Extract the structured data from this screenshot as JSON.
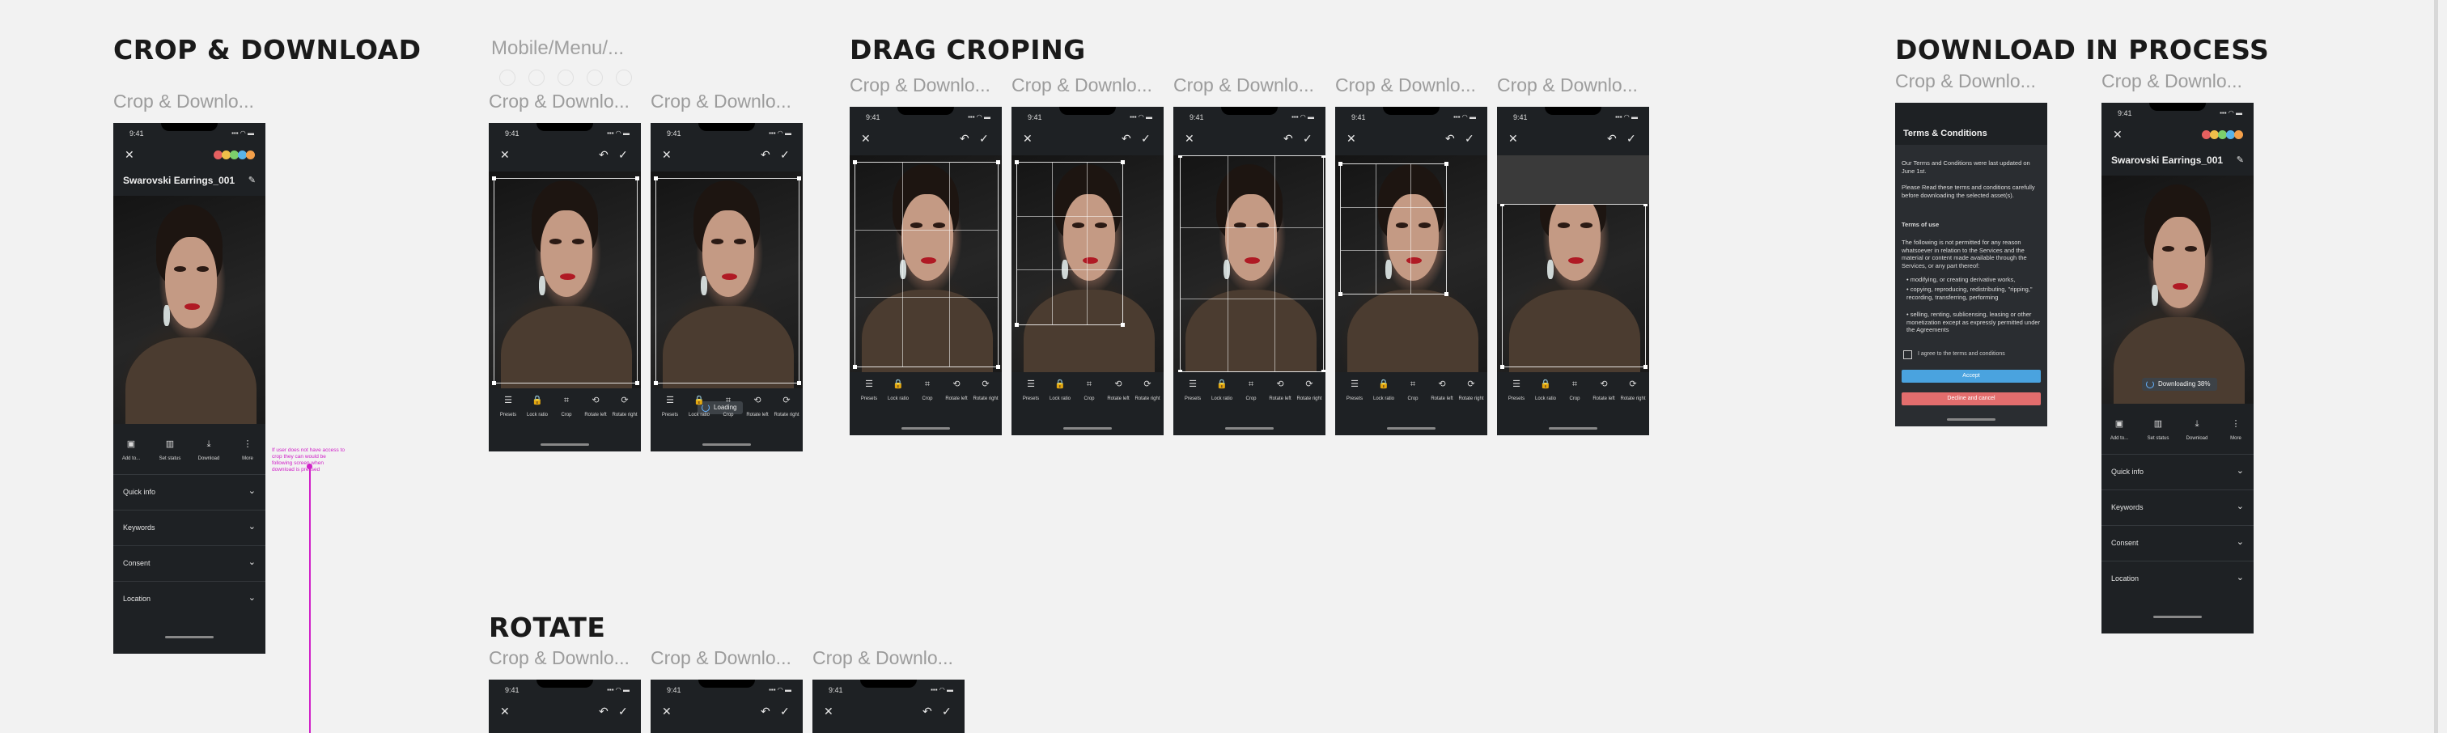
{
  "sections": {
    "crop_download": "CROP & DOWNLOAD",
    "mobile_menu": "Mobile/Menu/...",
    "drag_croping": "DRAG CROPING",
    "download_in_process": "DOWNLOAD IN PROCESS",
    "rotate": "ROTATE"
  },
  "frame_label": "Crop & Downlo...",
  "status": {
    "time": "9:41",
    "signal": "▪▪▪ ◠ ▬"
  },
  "asset": {
    "title": "Swarovski Earrings_001",
    "colors": [
      "#e56060",
      "#f0c04a",
      "#7ccf6b",
      "#59b3e8",
      "#f4a04a"
    ]
  },
  "detail_actions": [
    {
      "icon": "briefcase-icon",
      "glyph": "▣",
      "label": "Add to..."
    },
    {
      "icon": "chart-icon",
      "glyph": "▥",
      "label": "Set status"
    },
    {
      "icon": "download-icon",
      "glyph": "⤓",
      "label": "Download"
    },
    {
      "icon": "more-icon",
      "glyph": "⋮",
      "label": "More"
    }
  ],
  "accordion": [
    "Quick info",
    "Keywords",
    "Consent",
    "Location"
  ],
  "annotation": "If user does not have access to crop they can would be following screen when download is pressed",
  "crop_tools": [
    {
      "icon": "presets-icon",
      "glyph": "☰",
      "label": "Presets"
    },
    {
      "icon": "lock-icon",
      "glyph": "🔒",
      "label": "Lock ratio"
    },
    {
      "icon": "crop-icon",
      "glyph": "⌗",
      "label": "Crop"
    },
    {
      "icon": "rotate-left-icon",
      "glyph": "⟲",
      "label": "Rotate left"
    },
    {
      "icon": "rotate-right-icon",
      "glyph": "⟳",
      "label": "Rotate right"
    }
  ],
  "loading_label": "Loading",
  "downloading_label": "Downloading 38%",
  "terms": {
    "title": "Terms & Conditions",
    "p1": "Our Terms and Conditions were last updated on June 1st.",
    "p2": "Please Read these terms and conditions carefully before downloading the selected asset(s).",
    "subtitle": "Terms of use",
    "p3": "The following is not permitted for any reason whatsoever in relation to the Services and the material or content made available through the Services, or any part thereof:",
    "bullets": [
      "modifying, or creating derivative works,",
      "copying, reproducing, redistributing, \"ripping,\" recording, transferring, performing",
      "selling, renting, sublicensing, leasing or other monetization except as expressly permitted under the Agreements"
    ],
    "checkbox": "I agree to the terms and conditions",
    "accept": "Accept",
    "decline": "Decline and cancel"
  }
}
